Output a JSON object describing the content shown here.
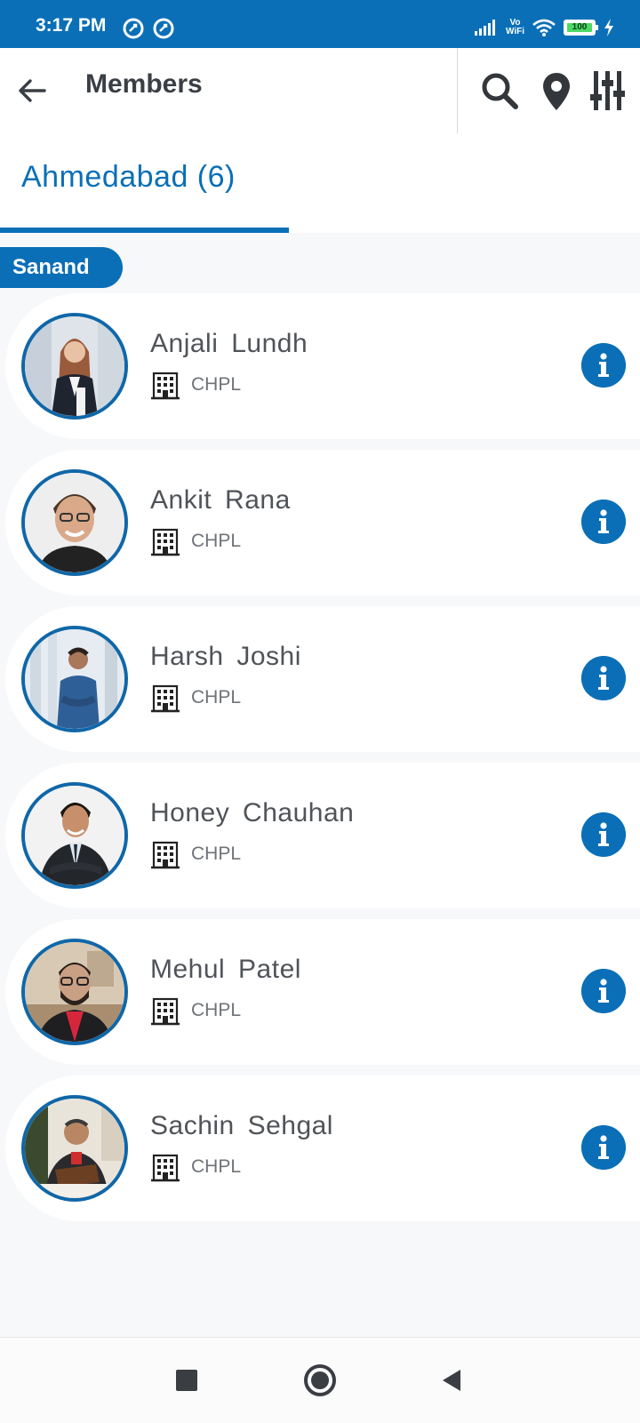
{
  "status_bar": {
    "time": "3:17 PM",
    "vowifi_line1": "Vo",
    "vowifi_line2": "WiFi",
    "battery_level": "100",
    "icons": [
      "notification-icon",
      "notification-icon",
      "signal-icon",
      "wifi-icon",
      "battery-icon",
      "charging-icon"
    ]
  },
  "header": {
    "title": "Members",
    "actions": [
      "search-icon",
      "location-pin-icon",
      "filter-sliders-icon"
    ]
  },
  "tabs": [
    {
      "label": "Ahmedabad (6)",
      "active": true
    }
  ],
  "section": {
    "label": "Sanand"
  },
  "members": [
    {
      "name": "Anjali  Lundh",
      "company": "CHPL"
    },
    {
      "name": "Ankit  Rana",
      "company": "CHPL"
    },
    {
      "name": "Harsh  Joshi",
      "company": "CHPL"
    },
    {
      "name": "Honey  Chauhan",
      "company": "CHPL"
    },
    {
      "name": "Mehul  Patel",
      "company": "CHPL"
    },
    {
      "name": "Sachin  Sehgal",
      "company": "CHPL"
    }
  ],
  "colors": {
    "primary": "#0a6fb7",
    "background": "#f7f8fa",
    "card": "#ffffff",
    "text": "#505459"
  },
  "nav_bar": [
    "recent-apps-icon",
    "home-icon",
    "back-icon"
  ]
}
